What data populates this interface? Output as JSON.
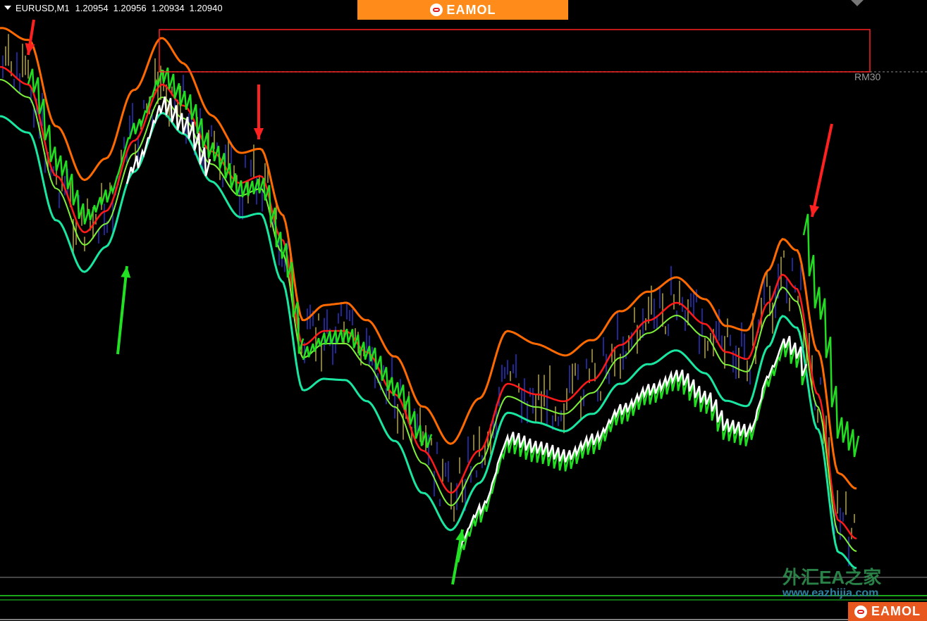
{
  "header": {
    "symbol": "EURUSD,M1",
    "open": "1.20954",
    "high": "1.20956",
    "low": "1.20934",
    "close": "1.20940"
  },
  "banner": {
    "brand": "EAMOL"
  },
  "corner_brand": {
    "brand": "EAMOL"
  },
  "levels": {
    "rm_label": "RM30"
  },
  "watermark": {
    "text": "外汇EA之家",
    "url": "www.eazhijia.com"
  },
  "colors": {
    "background": "#000000",
    "upper_band_orange": "#ff6a00",
    "mid_band_red": "#ff1a1a",
    "lower_band_teal": "#19e6a0",
    "sell_arrow": "#ff2020",
    "buy_arrow": "#22e022",
    "candle_bull": "#b8a62a",
    "candle_bear": "#2b33c8",
    "zone_box": "#ff2020",
    "banner_orange": "#ff8c1a"
  },
  "icons": [
    "eamol-logo-icon",
    "down-triangle-icon"
  ]
}
